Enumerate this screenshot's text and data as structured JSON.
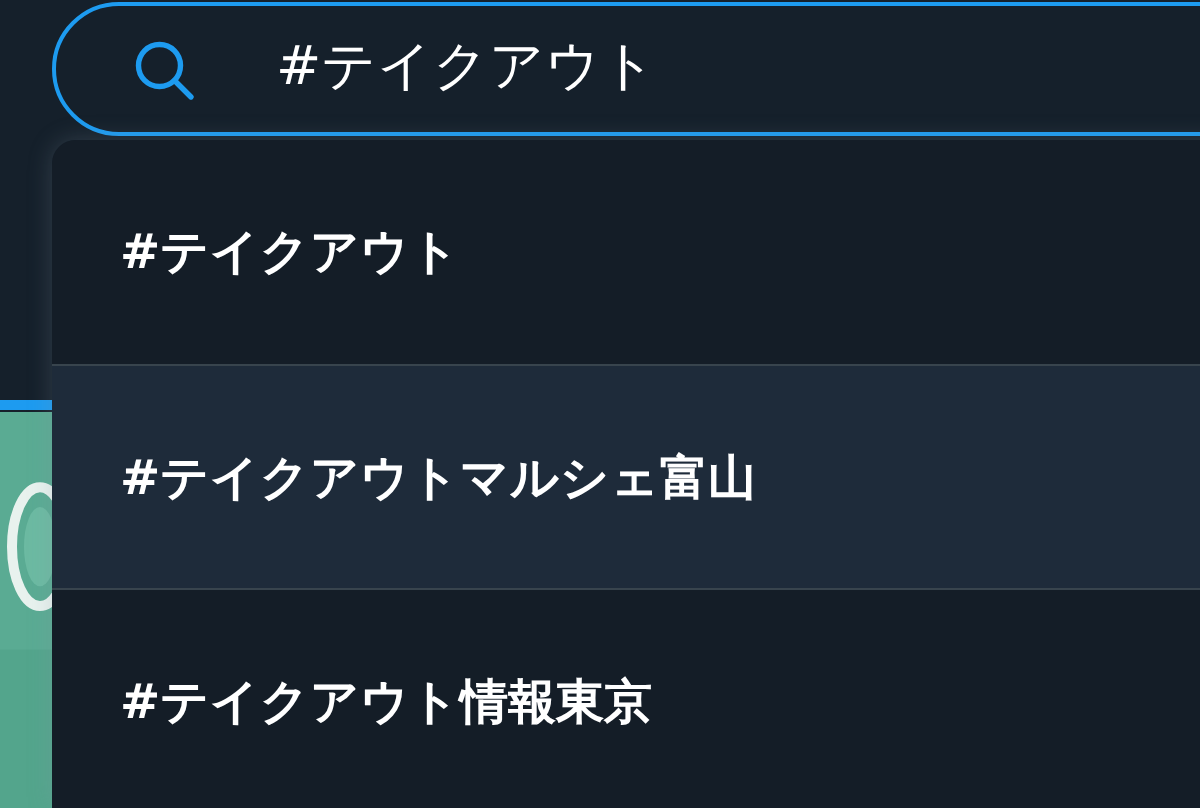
{
  "search": {
    "value": "#テイクアウト"
  },
  "suggestions": [
    {
      "text": "#テイクアウト",
      "selected": false
    },
    {
      "text": "#テイクアウトマルシェ富山",
      "selected": true
    },
    {
      "text": "#テイクアウト情報東京",
      "selected": false
    }
  ],
  "background_tab": {
    "selected": true
  }
}
